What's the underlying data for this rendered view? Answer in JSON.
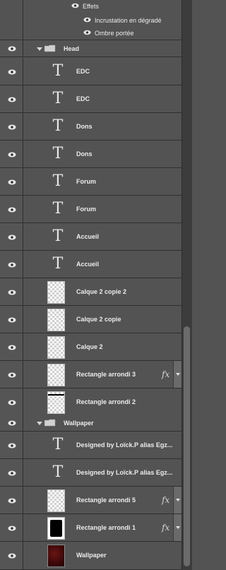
{
  "effects_block": {
    "header_label": "Effets",
    "effects": [
      {
        "label": "Incrustation en dégradé"
      },
      {
        "label": "Ombre portée"
      }
    ]
  },
  "groups": {
    "head": {
      "label": "Head"
    },
    "wallpaper": {
      "label": "Wallpaper"
    }
  },
  "layers": [
    {
      "label": "EDC",
      "kind": "text"
    },
    {
      "label": "EDC",
      "kind": "text"
    },
    {
      "label": "Dons",
      "kind": "text"
    },
    {
      "label": "Dons",
      "kind": "text"
    },
    {
      "label": "Forum",
      "kind": "text"
    },
    {
      "label": "Forum",
      "kind": "text"
    },
    {
      "label": "Accueil",
      "kind": "text"
    },
    {
      "label": "Accueil",
      "kind": "text"
    },
    {
      "label": "Calque 2 copie 2",
      "kind": "raster"
    },
    {
      "label": "Calque 2 copie",
      "kind": "raster"
    },
    {
      "label": "Calque 2",
      "kind": "raster"
    },
    {
      "label": "Rectangle arrondi 3",
      "kind": "shape",
      "fx": "fx"
    },
    {
      "label": "Rectangle arrondi 2",
      "kind": "shape-line"
    },
    {
      "label": "Designed by Loïck.P alias Egz...",
      "kind": "text"
    },
    {
      "label": "Designed by Loïck.P alias Egz...",
      "kind": "text"
    },
    {
      "label": "Rectangle arrondi 5",
      "kind": "shape",
      "fx": "fx"
    },
    {
      "label": "Rectangle arrondi 1",
      "kind": "shape-dark",
      "fx": "fx"
    },
    {
      "label": "Wallpaper",
      "kind": "wallpaper"
    }
  ],
  "icons": {
    "visibility": "eye-icon",
    "text_layer": "type-layer-icon",
    "folder": "folder-icon",
    "effects": "fx-icon"
  },
  "colors": {
    "panel_bg": "#535353",
    "divider": "#2f2f2f",
    "text": "#ececec"
  }
}
